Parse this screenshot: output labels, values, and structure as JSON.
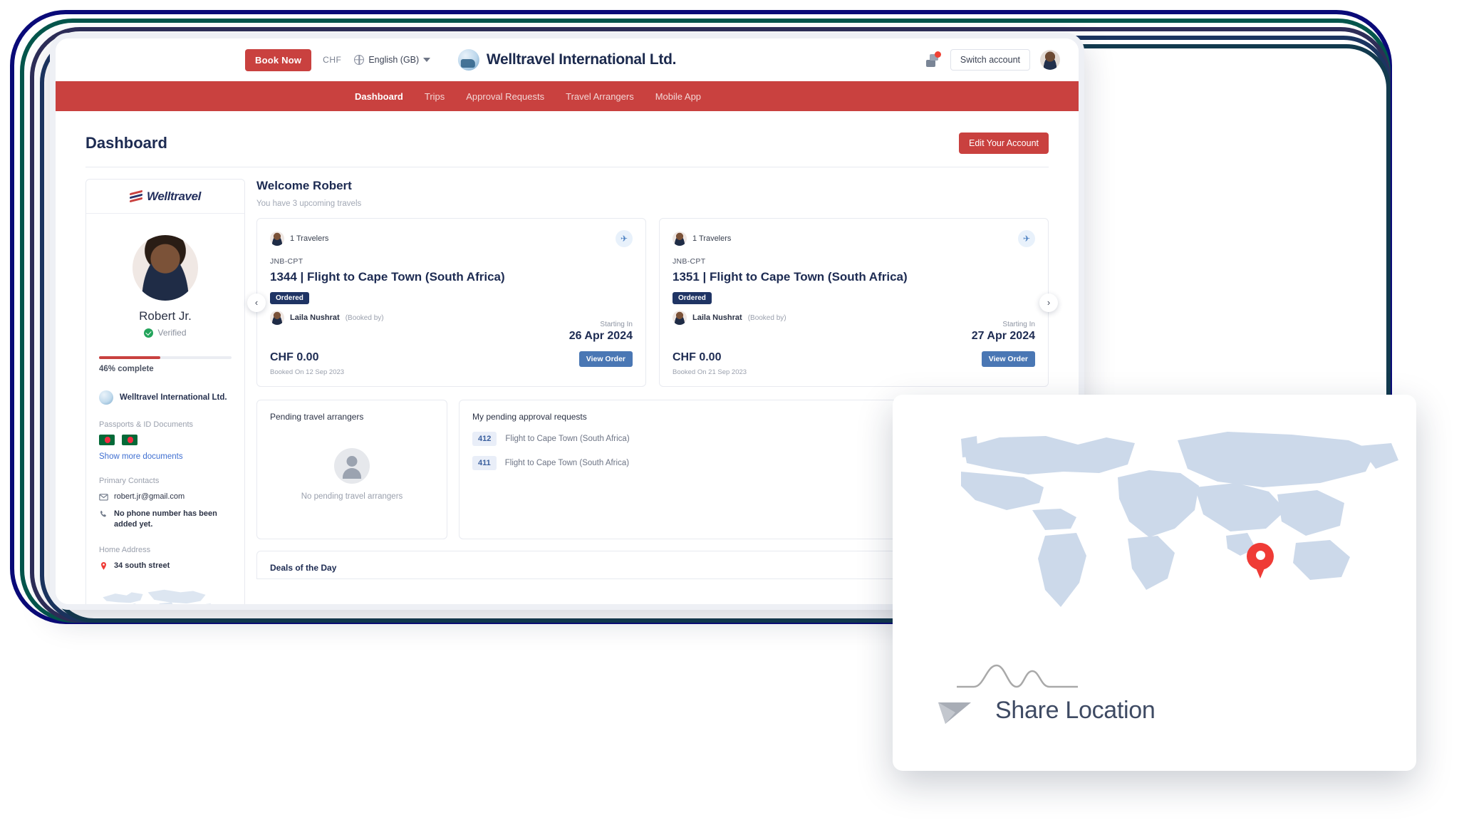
{
  "colors": {
    "brand_red": "#c9413f",
    "navy": "#1d2b52",
    "badge_navy": "#1f3464",
    "button_blue": "#4a77b4",
    "verified_green": "#23a45b",
    "pin_red": "#ef3b36"
  },
  "topbar": {
    "book_now": "Book Now",
    "currency": "CHF",
    "language": "English (GB)",
    "brand_name": "Welltravel International Ltd.",
    "switch_account": "Switch account",
    "chat_icon": "chat-icon",
    "globe_icon": "globe-icon",
    "avatar_icon": "user-avatar"
  },
  "nav": {
    "items": [
      {
        "label": "Dashboard",
        "active": true
      },
      {
        "label": "Trips",
        "active": false
      },
      {
        "label": "Approval Requests",
        "active": false
      },
      {
        "label": "Travel Arrangers",
        "active": false
      },
      {
        "label": "Mobile App",
        "active": false
      }
    ]
  },
  "page": {
    "title": "Dashboard",
    "edit_account": "Edit Your Account"
  },
  "sidebar": {
    "logo_text": "Welltravel",
    "user_name": "Robert Jr.",
    "verified_label": "Verified",
    "progress_percent": 46,
    "progress_label": "46% complete",
    "org_name": "Welltravel International Ltd.",
    "documents_label": "Passports & ID Documents",
    "show_more": "Show more documents",
    "flags": [
      "bangladesh-flag",
      "bangladesh-flag"
    ],
    "primary_contacts_label": "Primary Contacts",
    "email": "robert.jr@gmail.com",
    "phone_note": "No phone number has been added yet.",
    "home_address_label": "Home Address",
    "home_address": "34 south street"
  },
  "main": {
    "welcome": "Welcome Robert",
    "subtitle": "You have 3 upcoming travels",
    "prev_arrow": "‹",
    "next_arrow": "›",
    "trips": [
      {
        "travelers": "1 Travelers",
        "route": "JNB-CPT",
        "title": "1344 | Flight to Cape Town (South Africa)",
        "status": "Ordered",
        "booker_name": "Laila Nushrat",
        "booker_suffix": "(Booked by)",
        "starting_in_label": "Starting In",
        "starting_in_date": "26 Apr 2024",
        "price": "CHF 0.00",
        "booked_on": "Booked On 12 Sep 2023",
        "view_order": "View Order"
      },
      {
        "travelers": "1 Travelers",
        "route": "JNB-CPT",
        "title": "1351 | Flight to Cape Town (South Africa)",
        "status": "Ordered",
        "booker_name": "Laila Nushrat",
        "booker_suffix": "(Booked by)",
        "starting_in_label": "Starting In",
        "starting_in_date": "27 Apr 2024",
        "price": "CHF 0.00",
        "booked_on": "Booked On 21 Sep 2023",
        "view_order": "View Order"
      }
    ],
    "pending_arrangers": {
      "title": "Pending travel arrangers",
      "empty_text": "No pending travel arrangers"
    },
    "approval_requests": {
      "title": "My pending approval requests",
      "rows": [
        {
          "id": "412",
          "text": "Flight to Cape Town (South Africa)"
        },
        {
          "id": "411",
          "text": "Flight to Cape Town (South Africa)"
        }
      ]
    },
    "deals_title": "Deals of the Day"
  },
  "share_card": {
    "label": "Share Location",
    "send_icon": "send-icon",
    "pin_icon": "map-pin-icon"
  }
}
